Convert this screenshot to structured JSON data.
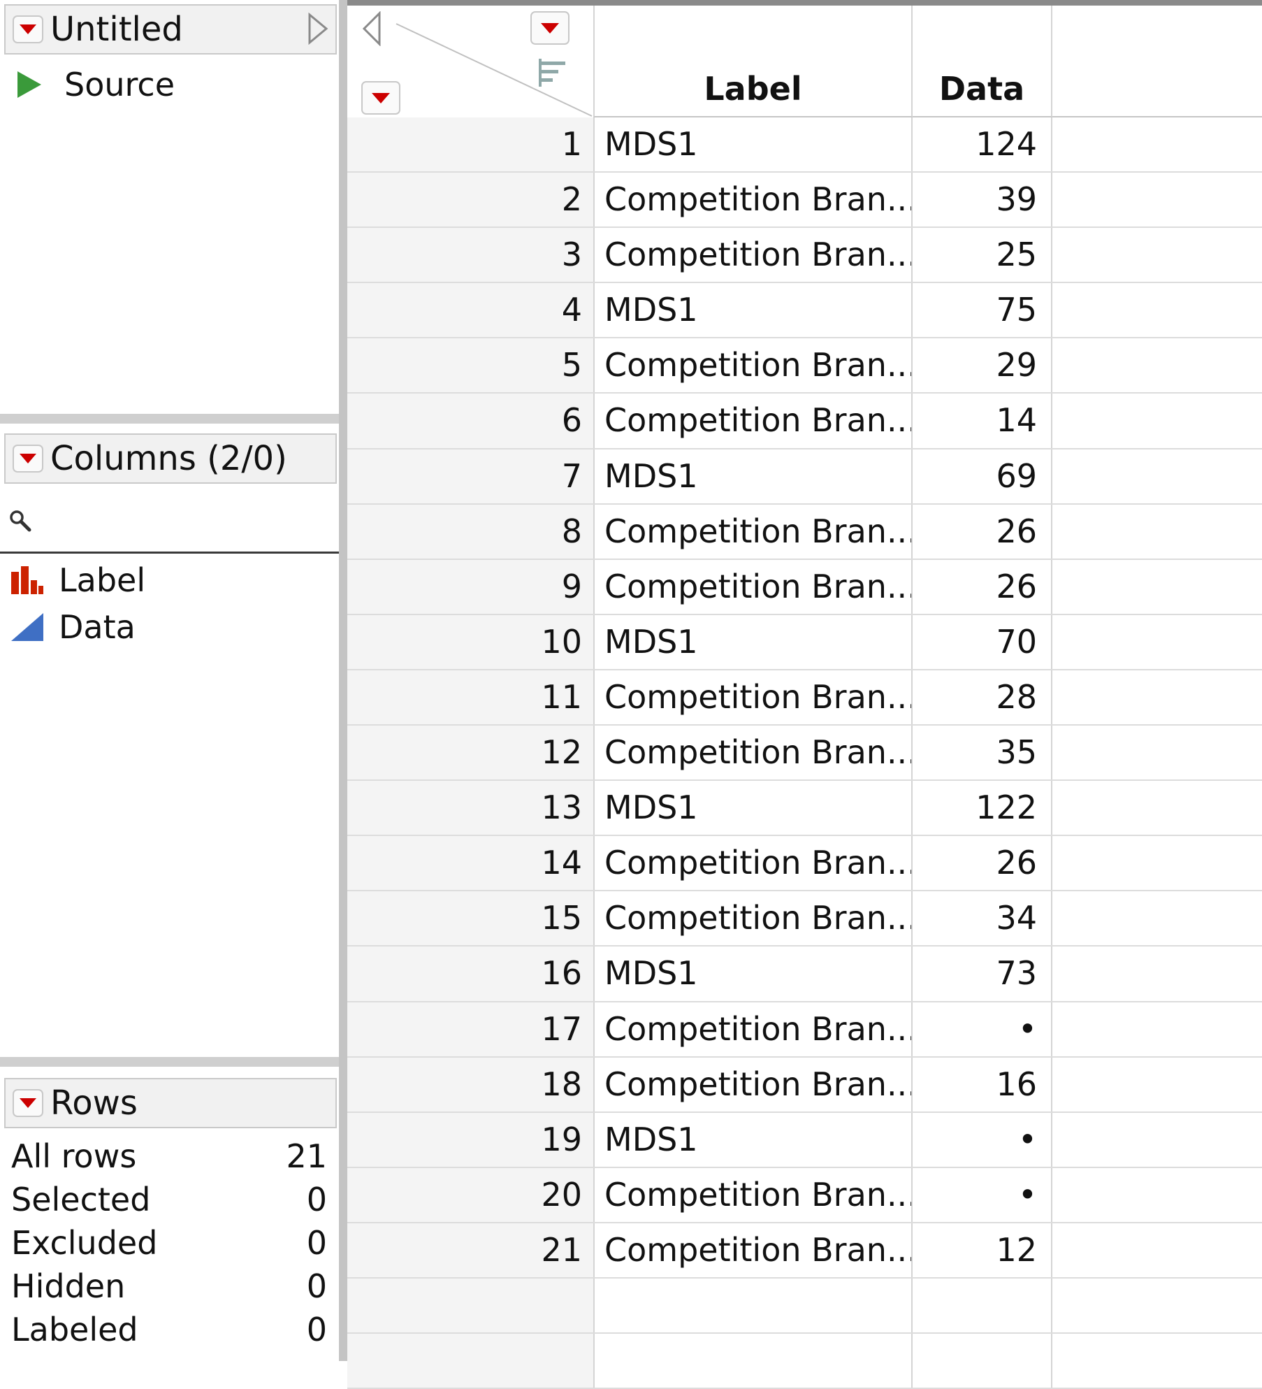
{
  "table_panel": {
    "title": "Untitled",
    "script_item": "Source"
  },
  "columns_panel": {
    "title": "Columns (2/0)",
    "search_placeholder": "",
    "columns": [
      {
        "name": "Label",
        "icon": "nominal-bar-icon"
      },
      {
        "name": "Data",
        "icon": "continuous-triangle-icon"
      }
    ]
  },
  "rows_panel": {
    "title": "Rows",
    "stats": [
      {
        "label": "All rows",
        "value": "21"
      },
      {
        "label": "Selected",
        "value": "0"
      },
      {
        "label": "Excluded",
        "value": "0"
      },
      {
        "label": "Hidden",
        "value": "0"
      },
      {
        "label": "Labeled",
        "value": "0"
      }
    ]
  },
  "grid": {
    "headers": {
      "label": "Label",
      "data": "Data"
    },
    "rows": [
      {
        "n": "1",
        "label": "MDS1",
        "data": "124"
      },
      {
        "n": "2",
        "label": "Competition Bran...",
        "data": "39"
      },
      {
        "n": "3",
        "label": "Competition Bran...",
        "data": "25"
      },
      {
        "n": "4",
        "label": "MDS1",
        "data": "75"
      },
      {
        "n": "5",
        "label": "Competition Bran...",
        "data": "29"
      },
      {
        "n": "6",
        "label": "Competition Bran...",
        "data": "14"
      },
      {
        "n": "7",
        "label": "MDS1",
        "data": "69"
      },
      {
        "n": "8",
        "label": "Competition Bran...",
        "data": "26"
      },
      {
        "n": "9",
        "label": "Competition Bran...",
        "data": "26"
      },
      {
        "n": "10",
        "label": "MDS1",
        "data": "70"
      },
      {
        "n": "11",
        "label": "Competition Bran...",
        "data": "28"
      },
      {
        "n": "12",
        "label": "Competition Bran...",
        "data": "35"
      },
      {
        "n": "13",
        "label": "MDS1",
        "data": "122"
      },
      {
        "n": "14",
        "label": "Competition Bran...",
        "data": "26"
      },
      {
        "n": "15",
        "label": "Competition Bran...",
        "data": "34"
      },
      {
        "n": "16",
        "label": "MDS1",
        "data": "73"
      },
      {
        "n": "17",
        "label": "Competition Bran...",
        "data": "•"
      },
      {
        "n": "18",
        "label": "Competition Bran...",
        "data": "16"
      },
      {
        "n": "19",
        "label": "MDS1",
        "data": "•"
      },
      {
        "n": "20",
        "label": "Competition Bran...",
        "data": "•"
      },
      {
        "n": "21",
        "label": "Competition Bran...",
        "data": "12"
      }
    ]
  },
  "colors": {
    "accent_red": "#cc0000",
    "run_green": "#3a9a3a",
    "continuous_blue": "#3f6fc4"
  }
}
